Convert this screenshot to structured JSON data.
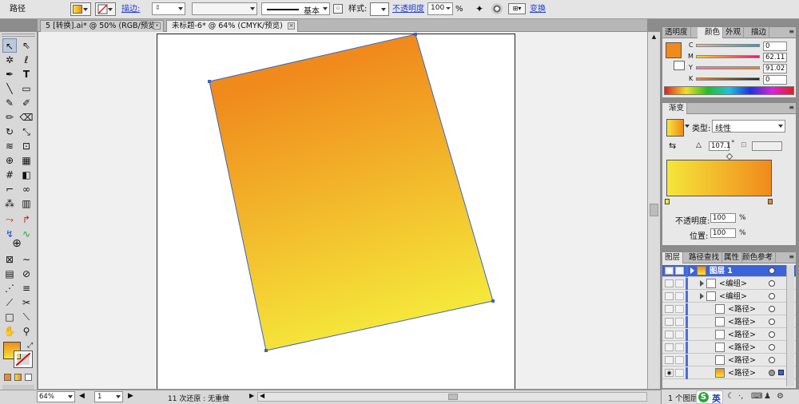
{
  "control_bar": {
    "object_type": "路径",
    "stroke_link": "描边:",
    "brush_value": "基本",
    "style_label": "样式:",
    "opacity_link": "不透明度",
    "opacity_value": "100",
    "opacity_unit": "%",
    "transform_link": "变换"
  },
  "doc_tabs": [
    {
      "label": "5 [转换].ai* @ 50% (RGB/预览)"
    },
    {
      "label": "未标题-6* @ 64% (CMYK/预览)"
    }
  ],
  "color_panel": {
    "tabs": [
      "透明度",
      "颜色",
      "外观",
      "描边"
    ],
    "channels": [
      {
        "name": "C",
        "value": "0"
      },
      {
        "name": "M",
        "value": "62.11"
      },
      {
        "name": "Y",
        "value": "91.02"
      },
      {
        "name": "K",
        "value": "0"
      }
    ]
  },
  "gradient_panel": {
    "title": "渐变",
    "type_label": "类型:",
    "type_value": "线性",
    "angle_value": "107.1",
    "angle_unit": "°",
    "opacity_label": "不透明度:",
    "opacity_value": "100",
    "location_label": "位置:",
    "location_value": "100",
    "percent": "%",
    "start_color": "#f5e63a",
    "end_color": "#f08a1c"
  },
  "layers_panel": {
    "tabs": [
      "图层",
      "路径查找",
      "属性",
      "颜色参考"
    ],
    "rows": [
      {
        "name": "图层 1"
      },
      {
        "name": "<编组>"
      },
      {
        "name": "<编组>"
      },
      {
        "name": "<路径>"
      },
      {
        "name": "<路径>"
      },
      {
        "name": "<路径>"
      },
      {
        "name": "<路径>"
      },
      {
        "name": "<路径>"
      },
      {
        "name": "<路径>"
      }
    ],
    "footer_text": "1 个图层"
  },
  "status_bar": {
    "zoom": "64%",
    "page": "1",
    "history": "11 次还原 : 无重做"
  },
  "ime": {
    "label": "英"
  },
  "colors": {
    "fill_top": "#f08a1c",
    "fill_bottom": "#f5e63a",
    "selection": "#3c64c8",
    "layer_highlight": "#3d63d8"
  }
}
